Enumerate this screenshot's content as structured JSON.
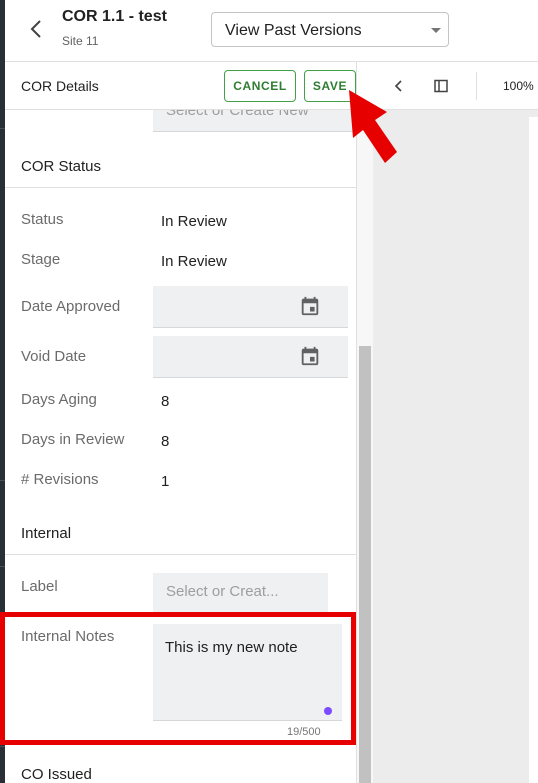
{
  "header": {
    "title": "COR 1.1 - test",
    "subtitle": "Site 11",
    "version_select": "View Past Versions"
  },
  "toolbar": {
    "label": "COR Details",
    "cancel_label": "CANCEL",
    "save_label": "SAVE"
  },
  "viewer": {
    "zoom": "100%"
  },
  "form": {
    "top_placeholder": "Select or Create New",
    "cor_status": {
      "title": "COR Status",
      "fields": {
        "status": {
          "label": "Status",
          "value": "In Review"
        },
        "stage": {
          "label": "Stage",
          "value": "In Review"
        },
        "date_approved": {
          "label": "Date Approved"
        },
        "void_date": {
          "label": "Void Date"
        },
        "days_aging": {
          "label": "Days Aging",
          "value": "8"
        },
        "days_in_review": {
          "label": "Days in Review",
          "value": "8"
        },
        "revisions": {
          "label": "# Revisions",
          "value": "1"
        }
      }
    },
    "internal": {
      "title": "Internal",
      "label_field": {
        "label": "Label",
        "placeholder": "Select or Creat..."
      },
      "notes": {
        "label": "Internal Notes",
        "value": "This is my new note",
        "counter": "19/500"
      }
    },
    "co_issued": {
      "label": "CO Issued"
    }
  },
  "colors": {
    "accent_green": "#2e7d32",
    "highlight_red": "#e60000",
    "resize_dot": "#7c4dff"
  }
}
